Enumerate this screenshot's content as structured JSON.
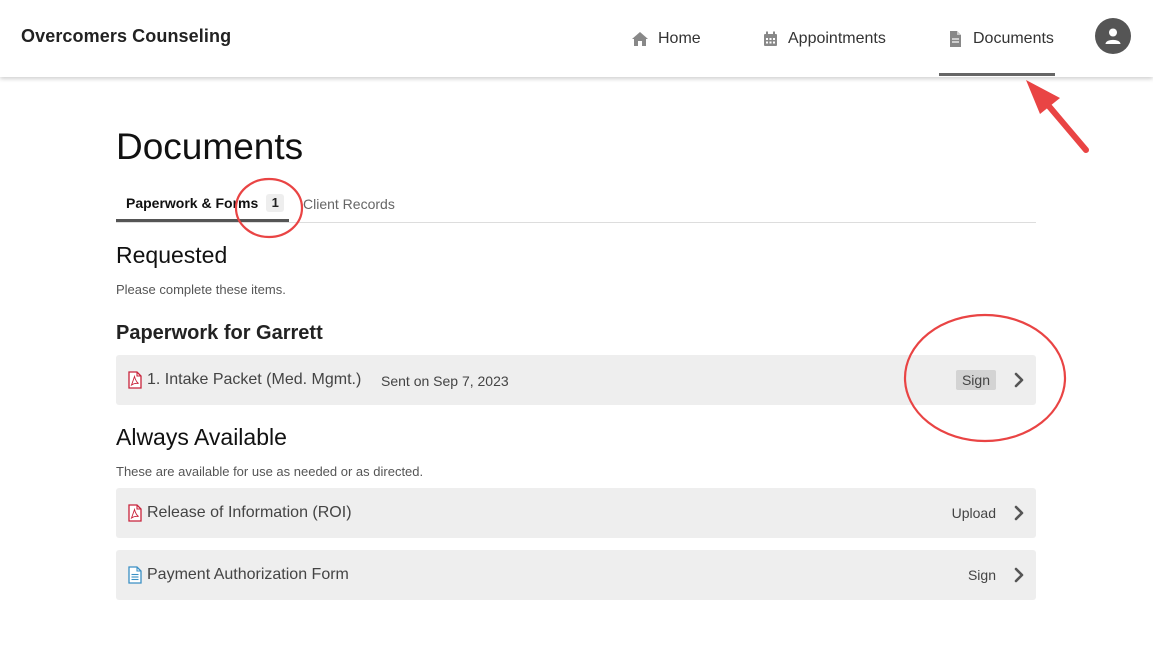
{
  "header": {
    "brand": "Overcomers Counseling",
    "nav": {
      "home": "Home",
      "appointments": "Appointments",
      "documents": "Documents"
    }
  },
  "page": {
    "title": "Documents"
  },
  "tabs": {
    "paperwork_label": "Paperwork & Forms",
    "paperwork_count": "1",
    "records_label": "Client Records"
  },
  "requested": {
    "heading": "Requested",
    "subtitle": "Please complete these items.",
    "group_heading": "Paperwork for Garrett",
    "items": [
      {
        "name": "1. Intake Packet (Med. Mgmt.)",
        "sent": "Sent on Sep 7, 2023",
        "action": "Sign",
        "icon": "pdf-icon"
      }
    ]
  },
  "always": {
    "heading": "Always Available",
    "subtitle": "These are available for use as needed or as directed.",
    "items": [
      {
        "name": "Release of Information (ROI)",
        "action": "Upload",
        "icon": "pdf-icon"
      },
      {
        "name": "Payment Authorization Form",
        "action": "Sign",
        "icon": "document-icon"
      }
    ]
  },
  "colors": {
    "pdf_icon": "#c8233b",
    "doc_icon": "#3a8fc4",
    "annotation": "#e94444",
    "row_bg": "#eeeeee"
  }
}
